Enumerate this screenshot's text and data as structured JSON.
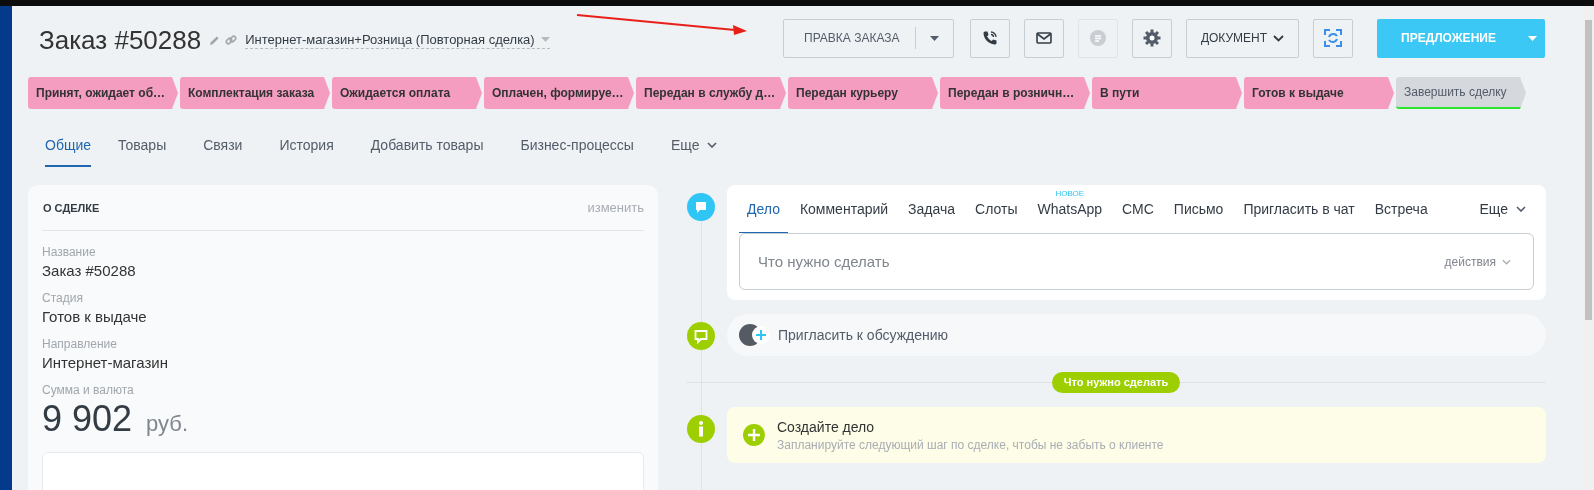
{
  "header": {
    "title": "Заказ #50288",
    "category": "Интернет-магазин+Розница (Повторная сделка)"
  },
  "toolbar": {
    "edit_label": "ПРАВКА ЗАКАЗА",
    "chat_disabled": true,
    "document_label": "ДОКУМЕНТ",
    "proposal_label": "ПРЕДЛОЖЕНИЕ"
  },
  "stages": [
    {
      "label": "Принят, ожидает об…",
      "kind": "passed"
    },
    {
      "label": "Комплектация заказа",
      "kind": "passed"
    },
    {
      "label": "Ожидается оплата",
      "kind": "passed"
    },
    {
      "label": "Оплачен, формируе…",
      "kind": "passed"
    },
    {
      "label": "Передан в службу д…",
      "kind": "passed"
    },
    {
      "label": "Передан курьеру",
      "kind": "passed"
    },
    {
      "label": "Передан в розничн…",
      "kind": "passed"
    },
    {
      "label": "В пути",
      "kind": "passed"
    },
    {
      "label": "Готов к выдаче",
      "kind": "passed"
    },
    {
      "label": "Завершить сделку",
      "kind": "final"
    }
  ],
  "tabs": [
    {
      "label": "Общие",
      "selected": true
    },
    {
      "label": "Товары",
      "selected": false
    },
    {
      "label": "Связи",
      "selected": false
    },
    {
      "label": "История",
      "selected": false
    },
    {
      "label": "Добавить товары",
      "selected": false
    },
    {
      "label": "Бизнес-процессы",
      "selected": false
    },
    {
      "label": "Еще",
      "selected": false
    }
  ],
  "deal_card": {
    "title": "О СДЕЛКЕ",
    "edit_link": "изменить",
    "fields": [
      {
        "label": "Название",
        "value": "Заказ #50288"
      },
      {
        "label": "Стадия",
        "value": "Готов к выдаче"
      },
      {
        "label": "Направление",
        "value": "Интернет-магазин"
      }
    ],
    "sum_label": "Сумма и валюта",
    "amount": "9 902",
    "currency": "руб."
  },
  "activity_tabs": [
    {
      "label": "Дело",
      "selected": true
    },
    {
      "label": "Комментарий",
      "selected": false
    },
    {
      "label": "Задача",
      "selected": false
    },
    {
      "label": "Слоты",
      "selected": false
    },
    {
      "label": "WhatsApp",
      "selected": false,
      "badge": "НОВОЕ"
    },
    {
      "label": "СМС",
      "selected": false
    },
    {
      "label": "Письмо",
      "selected": false
    },
    {
      "label": "Пригласить в чат",
      "selected": false
    },
    {
      "label": "Встреча",
      "selected": false
    }
  ],
  "activity_more": "Еще",
  "todo_field": {
    "placeholder": "Что нужно сделать",
    "actions": "действия"
  },
  "invite": {
    "label": "Пригласить к обсуждению"
  },
  "section_pill": "Что нужно сделать",
  "create_task": {
    "title": "Создайте дело",
    "subtitle": "Запланируйте следующий шаг по сделке, чтобы не забыть о клиенте"
  }
}
